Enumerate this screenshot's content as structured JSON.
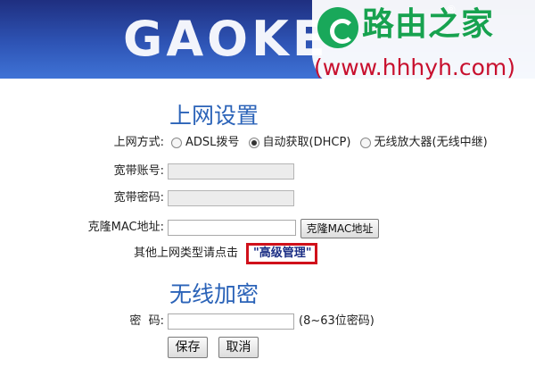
{
  "banner": {
    "brand": "GAOKE",
    "watermark_title": "路由之家",
    "watermark_url": "(www.hhhyh.com)",
    "watermark_reg": "®",
    "bg_color": "#2e54b5"
  },
  "internet": {
    "title": "上网设置",
    "mode_label": "上网方式:",
    "modes": [
      {
        "label": "ADSL拨号",
        "checked": false
      },
      {
        "label": "自动获取(DHCP)",
        "checked": true
      },
      {
        "label": "无线放大器(无线中继)",
        "checked": false
      }
    ],
    "account_label": "宽带账号:",
    "account_value": "",
    "password_label": "宽带密码:",
    "password_value": "",
    "clone_mac_label": "克隆MAC地址:",
    "clone_mac_value": "",
    "clone_mac_button": "克隆MAC地址",
    "other_type_text": "其他上网类型请点击",
    "advanced_link": "\"高级管理\"",
    "highlight_color": "#d0111b"
  },
  "wireless": {
    "title": "无线加密",
    "password_label": "密  码:",
    "password_value": "",
    "password_hint": "(8~63位密码)",
    "save_button": "保存",
    "cancel_button": "取消"
  }
}
